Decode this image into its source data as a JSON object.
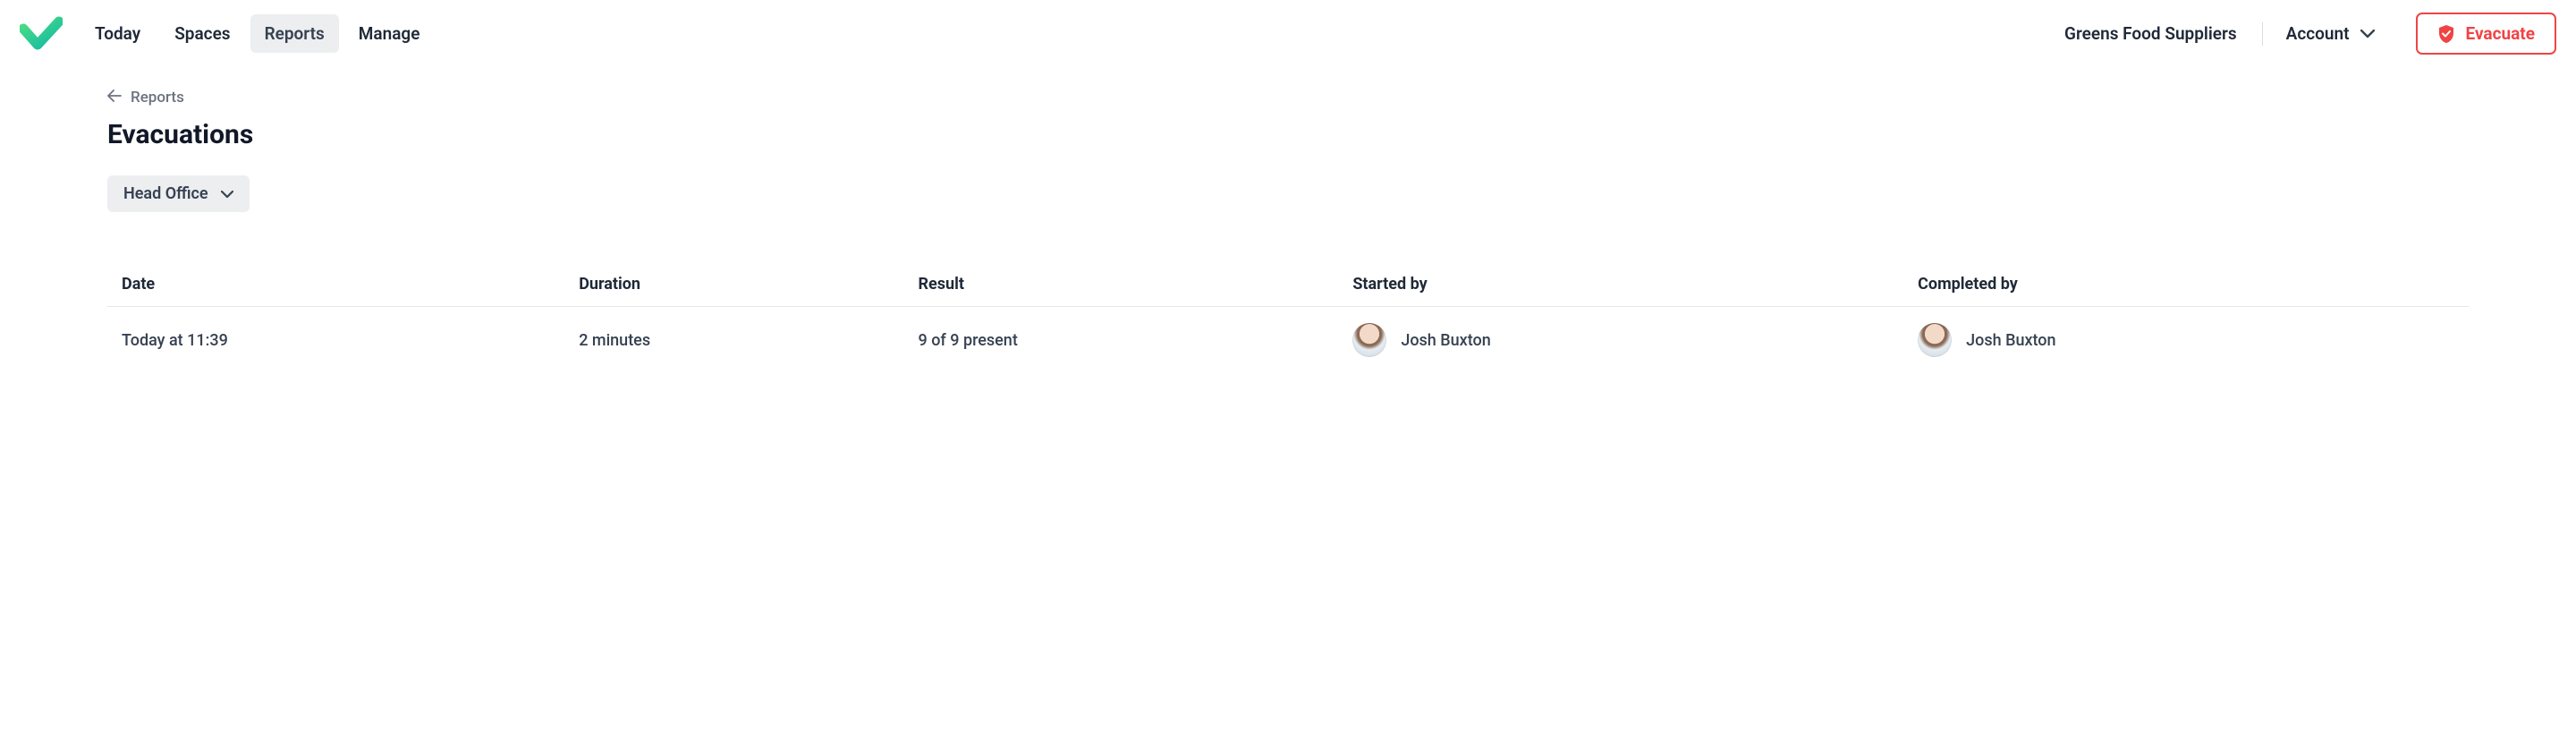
{
  "nav": {
    "items": [
      {
        "label": "Today"
      },
      {
        "label": "Spaces"
      },
      {
        "label": "Reports"
      },
      {
        "label": "Manage"
      }
    ]
  },
  "header": {
    "org_name": "Greens Food Suppliers",
    "account_label": "Account",
    "evacuate_label": "Evacuate"
  },
  "breadcrumb": {
    "back_label": "Reports"
  },
  "page": {
    "title": "Evacuations"
  },
  "filter": {
    "location_label": "Head Office"
  },
  "table": {
    "headers": {
      "date": "Date",
      "duration": "Duration",
      "result": "Result",
      "started_by": "Started by",
      "completed_by": "Completed by"
    },
    "rows": [
      {
        "date": "Today at 11:39",
        "duration": "2 minutes",
        "result": "9 of 9 present",
        "started_by": "Josh Buxton",
        "completed_by": "Josh Buxton"
      }
    ]
  }
}
